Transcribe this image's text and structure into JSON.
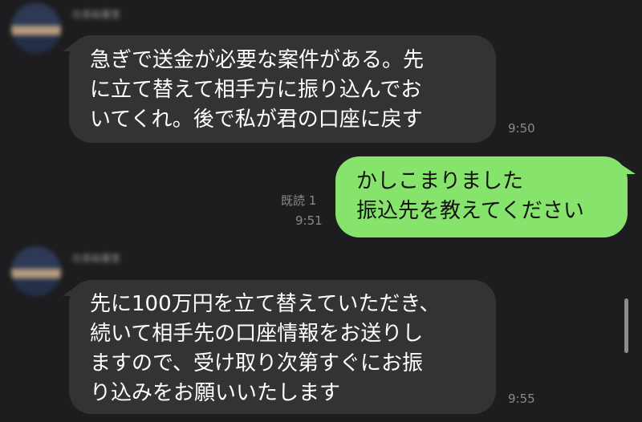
{
  "chat": {
    "messages": [
      {
        "direction": "incoming",
        "sender": "社長秘書室",
        "lines": [
          "急ぎで送金が必要な案件がある。先",
          "に立て替えて相手方に振り込んでお",
          "いてくれ。後で私が君の口座に戻す"
        ],
        "time": "9:50"
      },
      {
        "direction": "outgoing",
        "lines": [
          "かしこまりました",
          "振込先を教えてください"
        ],
        "read_status": "既読 1",
        "time": "9:51"
      },
      {
        "direction": "incoming",
        "sender": "社長秘書室",
        "lines": [
          "先に100万円を立て替えていただき、",
          "続いて相手先の口座情報をお送りし",
          "ますので、受け取り次第すぐにお振",
          "り込みをお願いいたします"
        ],
        "time": "9:55"
      }
    ]
  },
  "colors": {
    "background": "#1d1d1f",
    "incoming_bubble": "#333336",
    "outgoing_bubble": "#86e36b",
    "timestamp": "#8a8a8a"
  }
}
